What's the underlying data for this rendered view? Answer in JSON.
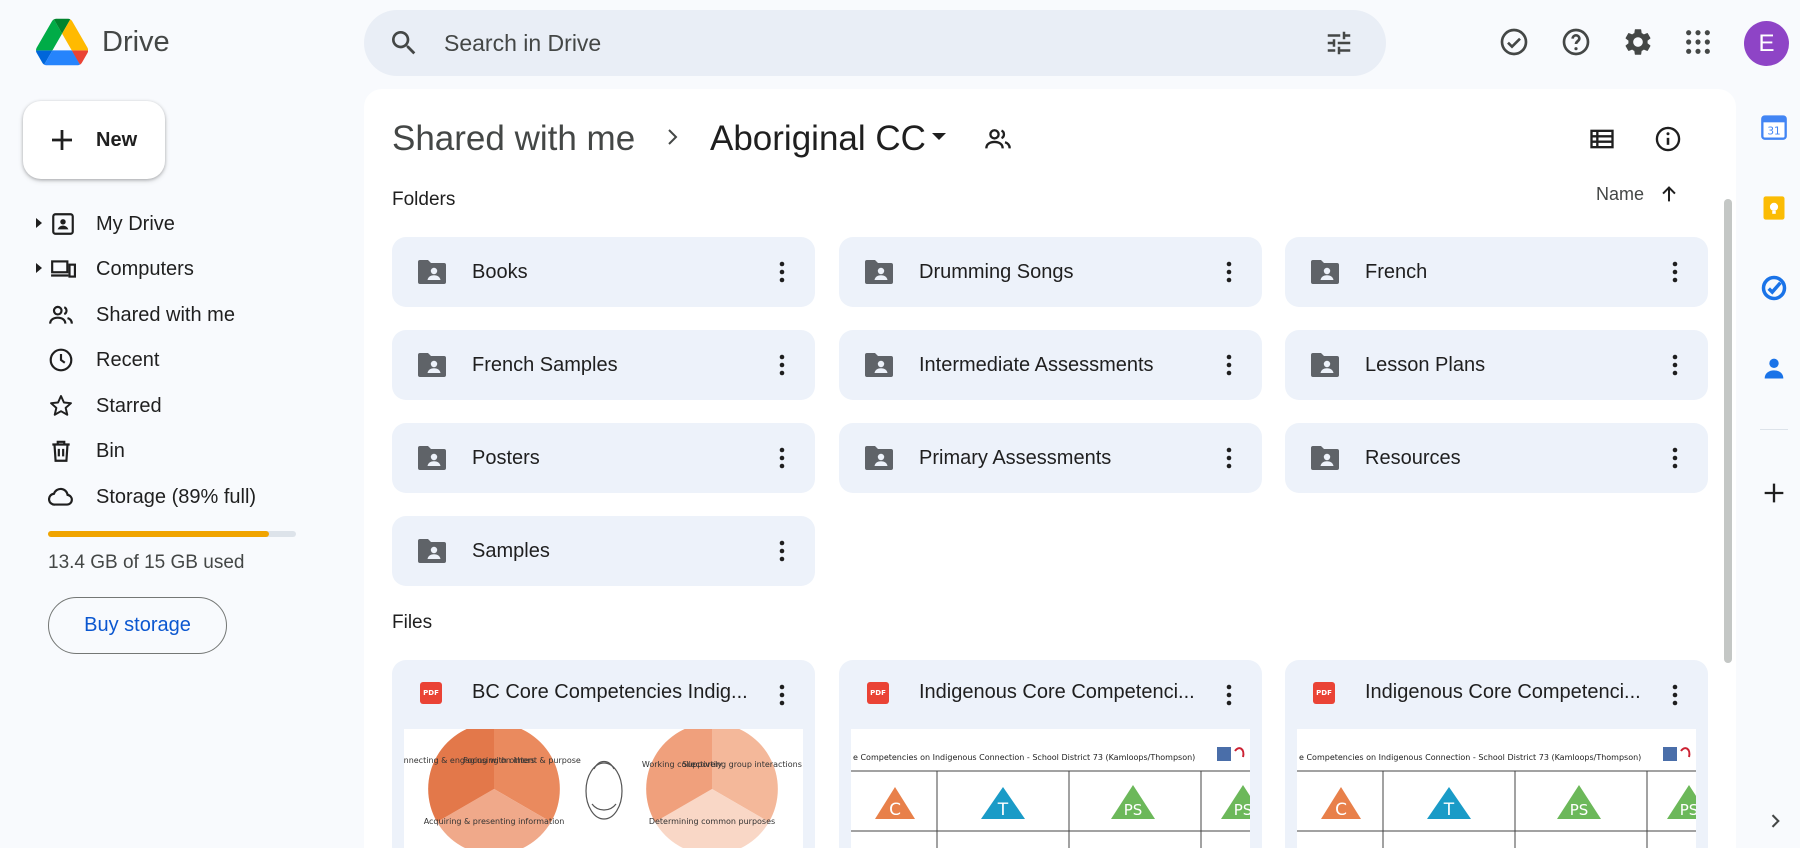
{
  "app": {
    "title": "Drive"
  },
  "search": {
    "placeholder": "Search in Drive"
  },
  "header": {
    "avatar_letter": "E"
  },
  "sidebar": {
    "new_label": "New",
    "items": [
      {
        "label": "My Drive",
        "icon": "my-drive-icon",
        "expandable": true
      },
      {
        "label": "Computers",
        "icon": "computers-icon",
        "expandable": true
      },
      {
        "label": "Shared with me",
        "icon": "people-icon",
        "expandable": false
      },
      {
        "label": "Recent",
        "icon": "clock-icon",
        "expandable": false
      },
      {
        "label": "Starred",
        "icon": "star-icon",
        "expandable": false
      },
      {
        "label": "Bin",
        "icon": "bin-icon",
        "expandable": false
      },
      {
        "label": "Storage (89% full)",
        "icon": "cloud-icon",
        "expandable": false
      }
    ],
    "storage_used_fraction": 0.89,
    "storage_text": "13.4 GB of 15 GB used",
    "buy_storage_label": "Buy storage"
  },
  "breadcrumb": {
    "parent": "Shared with me",
    "current": "Aboriginal CC"
  },
  "sort": {
    "label": "Name"
  },
  "folders_title": "Folders",
  "folders": [
    "Books",
    "Drumming Songs",
    "French",
    "French Samples",
    "Intermediate Assessments",
    "Lesson Plans",
    "Posters",
    "Primary Assessments",
    "Resources",
    "Samples"
  ],
  "files_title": "Files",
  "files": [
    {
      "name": "BC Core Competencies Indig...",
      "type_label": "PDF",
      "thumb": "pie-charts"
    },
    {
      "name": "Indigenous Core Competenci...",
      "type_label": "PDF",
      "thumb": "table"
    },
    {
      "name": "Indigenous Core Competenci...",
      "type_label": "PDF",
      "thumb": "table"
    }
  ],
  "thumbs": {
    "pie_left": [
      "Connecting & engaging with others",
      "Focusing on intent & purpose",
      "Acquiring & presenting information"
    ],
    "pie_right": [
      "Working collectively",
      "Supporting group interactions",
      "Determining common purposes"
    ],
    "table_header": "e Competencies on Indigenous Connection - School District 73 (Kamloops/Thompson)",
    "table_letters": [
      "C",
      "T",
      "PS",
      "PS"
    ]
  },
  "colors": {
    "accent": "#0b57d0",
    "storage": "#f0a400",
    "folder_bg": "#edf2fa",
    "avatar": "#8e44c6",
    "pdf": "#ea4335"
  }
}
